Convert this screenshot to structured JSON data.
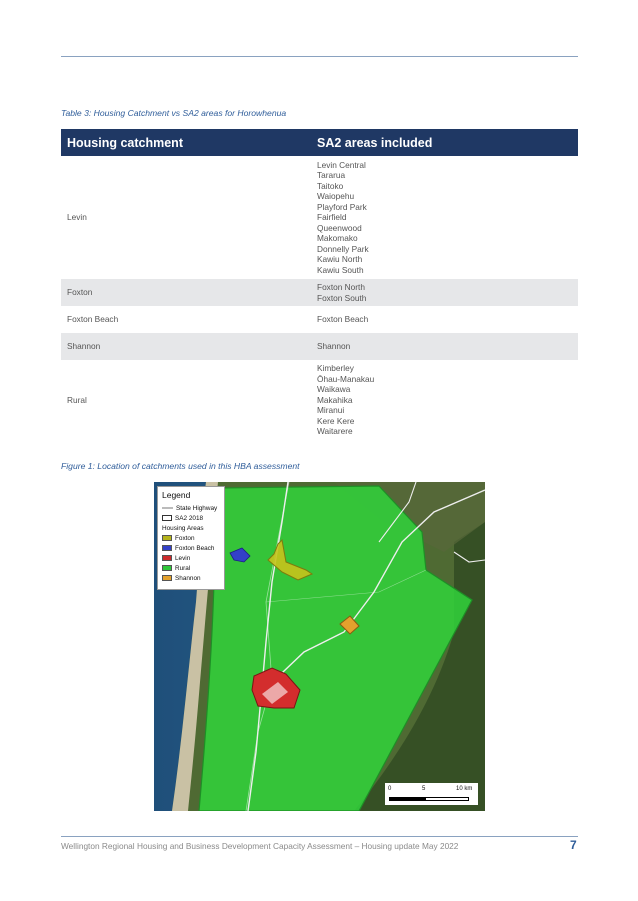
{
  "table": {
    "caption": "Table 3: Housing Catchment vs SA2 areas for Horowhenua",
    "headers": [
      "Housing catchment",
      "SA2 areas included"
    ],
    "rows": [
      {
        "catchment": "Levin",
        "sa2": [
          "Levin Central",
          "Tararua",
          "Taitoko",
          "Waiopehu",
          "Playford Park",
          "Fairfield",
          "Queenwood",
          "Makomako",
          "Donnelly Park",
          "Kawiu North",
          "Kawiu South"
        ]
      },
      {
        "catchment": "Foxton",
        "sa2": [
          "Foxton North",
          "Foxton South"
        ]
      },
      {
        "catchment": "Foxton Beach",
        "sa2": [
          "Foxton Beach"
        ]
      },
      {
        "catchment": "Shannon",
        "sa2": [
          "Shannon"
        ]
      },
      {
        "catchment": "Rural",
        "sa2": [
          "Kimberley",
          "Ōhau-Manakau",
          "Waikawa",
          "Makahika",
          "Miranui",
          "Kere Kere",
          "Waitarere"
        ]
      }
    ]
  },
  "figure": {
    "caption": "Figure 1: Location of catchments used in this HBA assessment",
    "legend": {
      "title": "Legend",
      "items": [
        {
          "label": "State Highway",
          "kind": "line",
          "color": "#dddddd"
        },
        {
          "label": "SA2 2018",
          "kind": "outline",
          "color": "#ffffff"
        },
        {
          "label": "Housing Areas",
          "kind": "heading",
          "color": ""
        },
        {
          "label": "Foxton",
          "kind": "fill",
          "color": "#b5b31b"
        },
        {
          "label": "Foxton Beach",
          "kind": "fill",
          "color": "#3340c8"
        },
        {
          "label": "Levin",
          "kind": "fill",
          "color": "#cc2b2b"
        },
        {
          "label": "Rural",
          "kind": "fill",
          "color": "#2fc63a"
        },
        {
          "label": "Shannon",
          "kind": "fill",
          "color": "#e3a12d"
        }
      ]
    },
    "scale_labels": [
      "0",
      "5",
      "10 km"
    ]
  },
  "footer": {
    "text": "Wellington Regional Housing and Business Development Capacity Assessment – Housing update May 2022",
    "page": "7"
  }
}
